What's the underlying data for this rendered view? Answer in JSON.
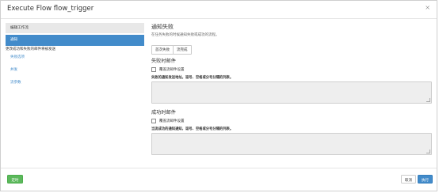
{
  "modal": {
    "title": "Execute Flow flow_trigger",
    "close_glyph": "×"
  },
  "sidebar": {
    "items": [
      {
        "label": "编辑工作流",
        "state": "default"
      },
      {
        "label": "通知",
        "state": "active"
      }
    ],
    "note": "更改成功和失败的邮件将被发送",
    "links": [
      "失败选项",
      "并发",
      "流参数"
    ]
  },
  "content": {
    "section_title": "通知失败",
    "section_help": "在任务失败的时候通知失败或成功的流程。",
    "tabs": [
      "首次失败",
      "流完成"
    ],
    "failure": {
      "title": "失败时邮件",
      "override_label": "覆盖流邮件设置",
      "field_label": "失败的通知发送地址。逗号、空格或分号分隔的列表。",
      "value": ""
    },
    "success": {
      "title": "成功时邮件",
      "override_label": "覆盖流邮件设置",
      "field_label": "当流成功的通知通知，逗号、空格或分号分隔的列表。",
      "value": ""
    }
  },
  "footer": {
    "schedule_label": "定时",
    "cancel_label": "取消",
    "execute_label": "执行"
  },
  "colors": {
    "primary": "#428bca",
    "success": "#5cb85c",
    "sidebar_grey": "#e8e8e8",
    "textarea_bg": "#eeeeee"
  }
}
